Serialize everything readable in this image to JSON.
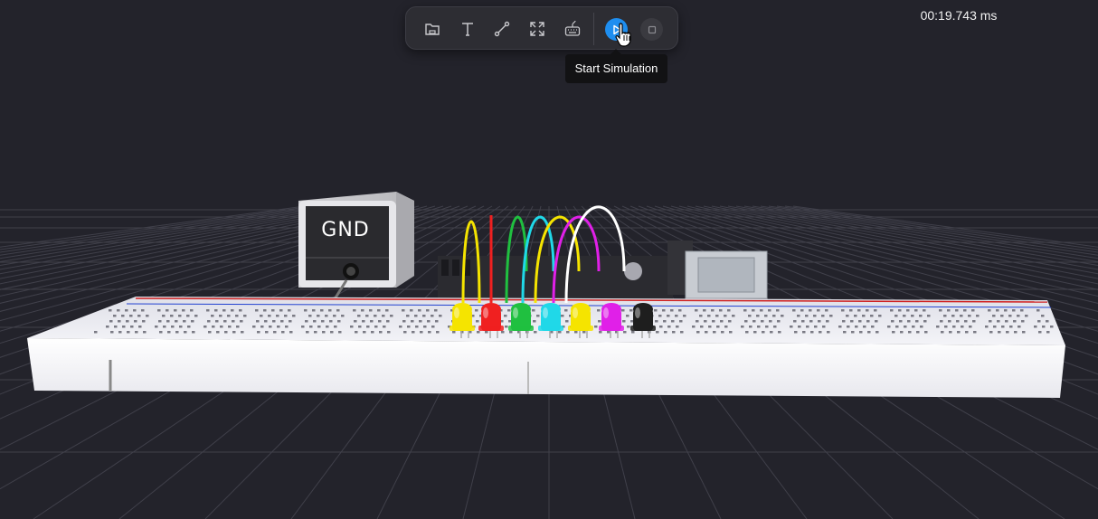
{
  "toolbar": {
    "items": [
      {
        "name": "open-folder",
        "icon": "folder-icon"
      },
      {
        "name": "add-text",
        "icon": "text-icon"
      },
      {
        "name": "draw-wire",
        "icon": "wire-icon"
      },
      {
        "name": "fullscreen",
        "icon": "expand-icon"
      },
      {
        "name": "keyboard",
        "icon": "keyboard-icon"
      }
    ],
    "play": {
      "icon": "play-icon",
      "color": "#1e8ef0"
    },
    "stop": {
      "icon": "stop-icon"
    }
  },
  "tooltip": {
    "text": "Start Simulation"
  },
  "timer": {
    "text": "00:19.743 ms"
  },
  "scene": {
    "gnd_label": "GND",
    "led_colors": [
      "#f5e400",
      "#f02020",
      "#20c040",
      "#20d8e8",
      "#f5e400",
      "#e020e8",
      "#1e1e1e"
    ],
    "wire_colors": [
      "#f5e400",
      "#f02020",
      "#20c040",
      "#20d8e8",
      "#f5e400",
      "#e020e8",
      "#ffffff"
    ]
  }
}
